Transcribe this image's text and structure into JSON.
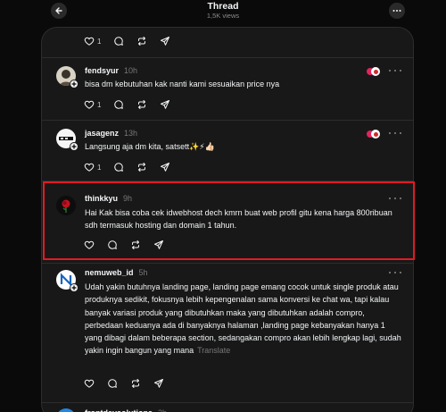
{
  "header": {
    "title": "Thread",
    "views": "1,5K views"
  },
  "posts": [
    {
      "username": "",
      "time": "",
      "text": "",
      "like_count": "1"
    },
    {
      "username": "fendsyur",
      "time": "10h",
      "text": "bisa dm kebutuhan kak nanti kami sesuaikan price nya",
      "like_count": "1"
    },
    {
      "username": "jasagenz",
      "time": "13h",
      "text": "Langsung aja dm kita, satsett✨⚡👍🏻",
      "like_count": "1"
    },
    {
      "username": "thinkkyu",
      "time": "9h",
      "text": "Hai Kak bisa coba cek idwebhost dech kmrn buat web profil gitu kena harga 800ribuan sdh termasuk hosting dan domain 1 tahun.",
      "like_count": ""
    },
    {
      "username": "nemuweb_id",
      "time": "5h",
      "text": "Udah yakin butuhnya landing page, landing page emang cocok untuk single produk atau produknya sedikit, fokusnya lebih kepengenalan sama konversi ke chat wa, tapi kalau banyak variasi produk yang dibutuhkan maka yang dibutuhkan adalah compro, perbedaan keduanya ada di banyaknya halaman ,landing page kebanyakan hanya 1 yang dibagi dalam beberapa section, sedangakan compro akan lebih lengkap lagi, sudah yakin ingin bangun yang mana",
      "translate_label": "Translate",
      "like_count": ""
    },
    {
      "username": "frontdevsolutions",
      "time": "3h",
      "text": "",
      "like_count": ""
    }
  ],
  "colors": {
    "background": "#0a0a0a",
    "panel": "#181818",
    "divider": "#2d2d2d",
    "highlight": "#e01b24",
    "text": "#f3f5f7",
    "muted": "#777777"
  }
}
